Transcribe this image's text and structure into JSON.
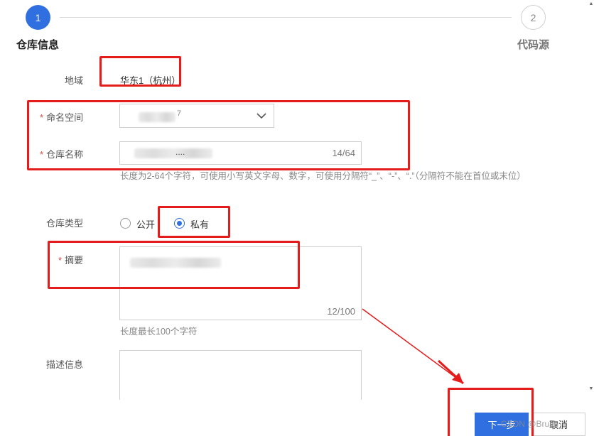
{
  "stepper": {
    "step1": {
      "number": "1",
      "title": "仓库信息"
    },
    "step2": {
      "number": "2",
      "title": "代码源"
    }
  },
  "form": {
    "region": {
      "label": "地域",
      "value": "华东1（杭州）"
    },
    "namespace": {
      "label": "命名空间",
      "value": "·····7"
    },
    "repo_name": {
      "label": "仓库名称",
      "value": "....",
      "counter": "14/64"
    },
    "repo_name_help": "长度为2-64个字符，可使用小写英文字母、数字，可使用分隔符“_”、“-”、“.”（分隔符不能在首位或末位）",
    "repo_type": {
      "label": "仓库类型",
      "options": [
        "公开",
        "私有"
      ],
      "selected": "私有"
    },
    "summary": {
      "label": "摘要",
      "counter": "12/100",
      "help": "长度最长100个字符"
    },
    "description": {
      "label": "描述信息"
    }
  },
  "buttons": {
    "next": "下一步",
    "cancel": "取消"
  },
  "watermark": "CSDN @Brush_",
  "colors": {
    "primary": "#2f6fe0",
    "annotation": "#e41c1c",
    "required": "#e0463c"
  }
}
